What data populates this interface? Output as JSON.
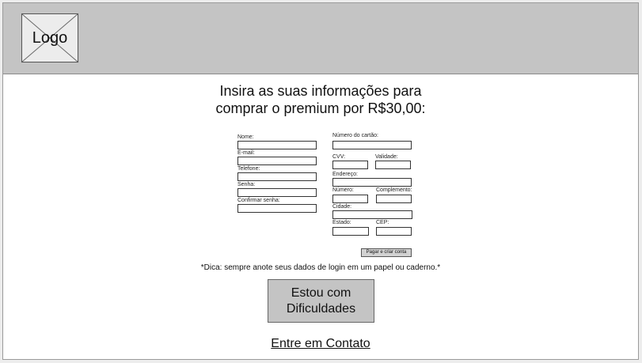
{
  "header": {
    "logo_text": "Logo"
  },
  "main": {
    "title_line1": "Insira as suas informações para",
    "title_line2": "comprar o premium por R$30,00:"
  },
  "form": {
    "left": {
      "name_label": "Nome:",
      "email_label": "E-mail:",
      "phone_label": "Telefone:",
      "password_label": "Senha:",
      "confirm_password_label": "Confirmar senha:"
    },
    "right": {
      "card_number_label": "Número do cartão:",
      "cvv_label": "CVV:",
      "expiry_label": "Validade:",
      "address_label": "Endereço:",
      "number_label": "Número:",
      "complement_label": "Complemento:",
      "city_label": "Cidade:",
      "state_label": "Estado:",
      "zip_label": "CEP:"
    },
    "submit_label": "Pagar e criar conta"
  },
  "tip": "*Dica: sempre anote seus dados de login em um papel ou caderno.*",
  "help_button_line1": "Estou com",
  "help_button_line2": "Dificuldades",
  "contact_link": "Entre em Contato"
}
